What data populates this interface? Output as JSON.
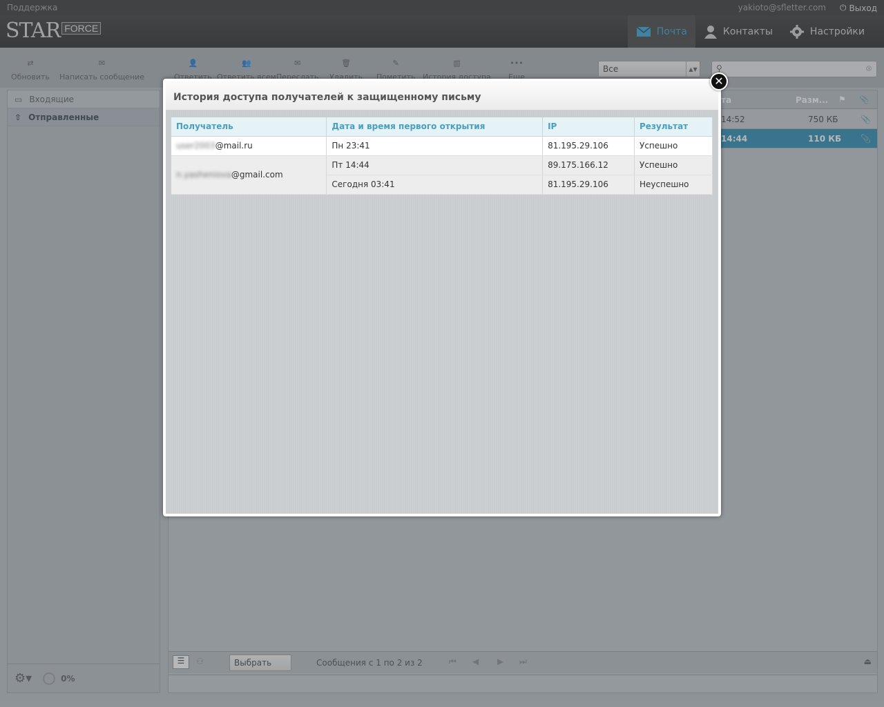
{
  "topbar": {
    "support": "Поддержка",
    "user": "yakioto@sfletter.com",
    "logout": "Выход"
  },
  "logo": {
    "star": "STAR",
    "force": "FORCE"
  },
  "nav": [
    {
      "label": "Почта",
      "icon": "mail-icon",
      "active": true
    },
    {
      "label": "Контакты",
      "icon": "person-icon",
      "active": false
    },
    {
      "label": "Настройки",
      "icon": "gear-icon",
      "active": false
    }
  ],
  "toolbar": {
    "refresh": "Обновить",
    "compose": "Написать сообщение",
    "reply": "Ответить",
    "reply_all": "Ответить всем",
    "forward": "Переслать",
    "delete": "Удалить",
    "mark": "Пометить",
    "history": "История доступа",
    "more": "Еще",
    "filter": "Все",
    "search_placeholder": ""
  },
  "sidebar": {
    "folders": [
      {
        "label": "Входящие",
        "icon": "inbox-icon",
        "active": false
      },
      {
        "label": "Отправленные",
        "icon": "sent-icon",
        "active": true
      }
    ],
    "quota": "0%"
  },
  "list": {
    "columns": {
      "date": "та",
      "size": "Разм..."
    },
    "rows": [
      {
        "date": "14:52",
        "size": "750 КБ",
        "selected": false
      },
      {
        "date": "14:44",
        "size": "110 КБ",
        "selected": true
      }
    ]
  },
  "pager": {
    "select": "Выбрать",
    "info": "Сообщения с 1 по 2 из 2"
  },
  "modal": {
    "title": "История доступа получателей к защищенному письму",
    "columns": {
      "recipient": "Получатель",
      "datetime": "Дата и время первого открытия",
      "ip": "IP",
      "result": "Результат"
    },
    "recipients": [
      {
        "name_hidden": "user2003",
        "domain": "@mail.ru",
        "entries": [
          {
            "datetime": "Пн 23:41",
            "ip": "81.195.29.106",
            "result": "Успешно"
          }
        ]
      },
      {
        "name_hidden": "n.yasheniova",
        "domain": "@gmail.com",
        "entries": [
          {
            "datetime": "Пт 14:44",
            "ip": "89.175.166.12",
            "result": "Успешно"
          },
          {
            "datetime": "Сегодня 03:41",
            "ip": "81.195.29.106",
            "result": "Неуспешно"
          }
        ]
      }
    ]
  }
}
